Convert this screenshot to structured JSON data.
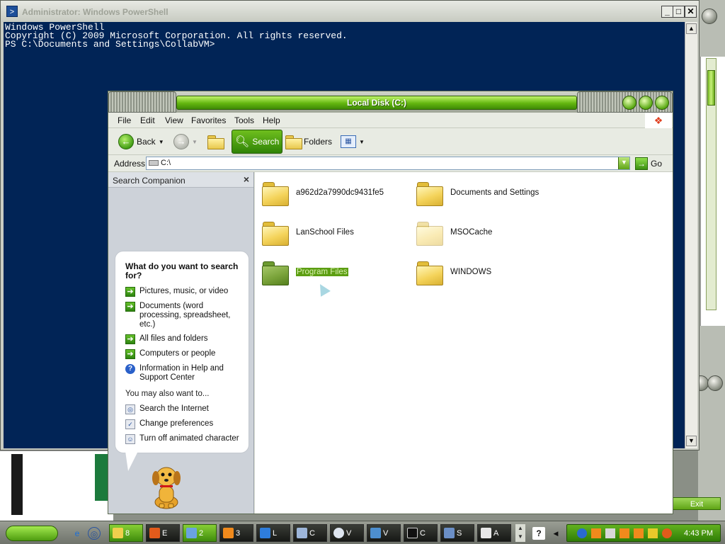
{
  "powershell": {
    "title": "Administrator: Windows PowerShell",
    "console_lines": [
      "Windows PowerShell",
      "Copyright (C) 2009 Microsoft Corporation. All rights reserved.",
      "",
      "PS C:\\Documents and Settings\\CollabVM>"
    ],
    "minimize": "_",
    "maximize": "□",
    "close": "✕"
  },
  "explorer": {
    "title": "Local Disk (C:)",
    "menu": [
      "File",
      "Edit",
      "View",
      "Favorites",
      "Tools",
      "Help"
    ],
    "toolbar": {
      "back": "Back",
      "search": "Search",
      "folders": "Folders"
    },
    "address": {
      "label": "Address",
      "value": "C:\\",
      "go": "Go"
    },
    "companion": {
      "header": "Search Companion",
      "question": "What do you want to search for?",
      "options": [
        "Pictures, music, or video",
        "Documents (word processing, spreadsheet, etc.)",
        "All files and folders",
        "Computers or people",
        "Information in Help and Support Center"
      ],
      "also_label": "You may also want to...",
      "also_options": [
        "Search the Internet",
        "Change preferences",
        "Turn off animated character"
      ]
    },
    "folders": [
      {
        "name": "a962d2a7990dc9431fe5"
      },
      {
        "name": "Documents and Settings"
      },
      {
        "name": "LanSchool Files"
      },
      {
        "name": "MSOCache"
      },
      {
        "name": "Program Files"
      },
      {
        "name": "WINDOWS"
      }
    ],
    "selected_folder": "Program Files"
  },
  "background": {
    "exit_label": "Exit"
  },
  "taskbar": {
    "buttons": [
      {
        "label": "8",
        "icon": "folder-icon"
      },
      {
        "label": "E",
        "icon": "search-icon"
      },
      {
        "label": "2",
        "icon": "explorer-icon"
      },
      {
        "label": "3",
        "icon": "vlc-icon"
      },
      {
        "label": "L",
        "icon": "ie-icon"
      },
      {
        "label": "C",
        "icon": "computer-icon"
      },
      {
        "label": "V",
        "icon": "media-icon"
      },
      {
        "label": "V",
        "icon": "network-icon"
      },
      {
        "label": "C",
        "icon": "cmd-icon"
      },
      {
        "label": "S",
        "icon": "link-icon"
      },
      {
        "label": "A",
        "icon": "doc-icon"
      }
    ],
    "clock": "4:43 PM"
  },
  "colors": {
    "console_bg": "#012456",
    "accent_green": "#5fa416",
    "selection_green": "#5c9e12"
  }
}
